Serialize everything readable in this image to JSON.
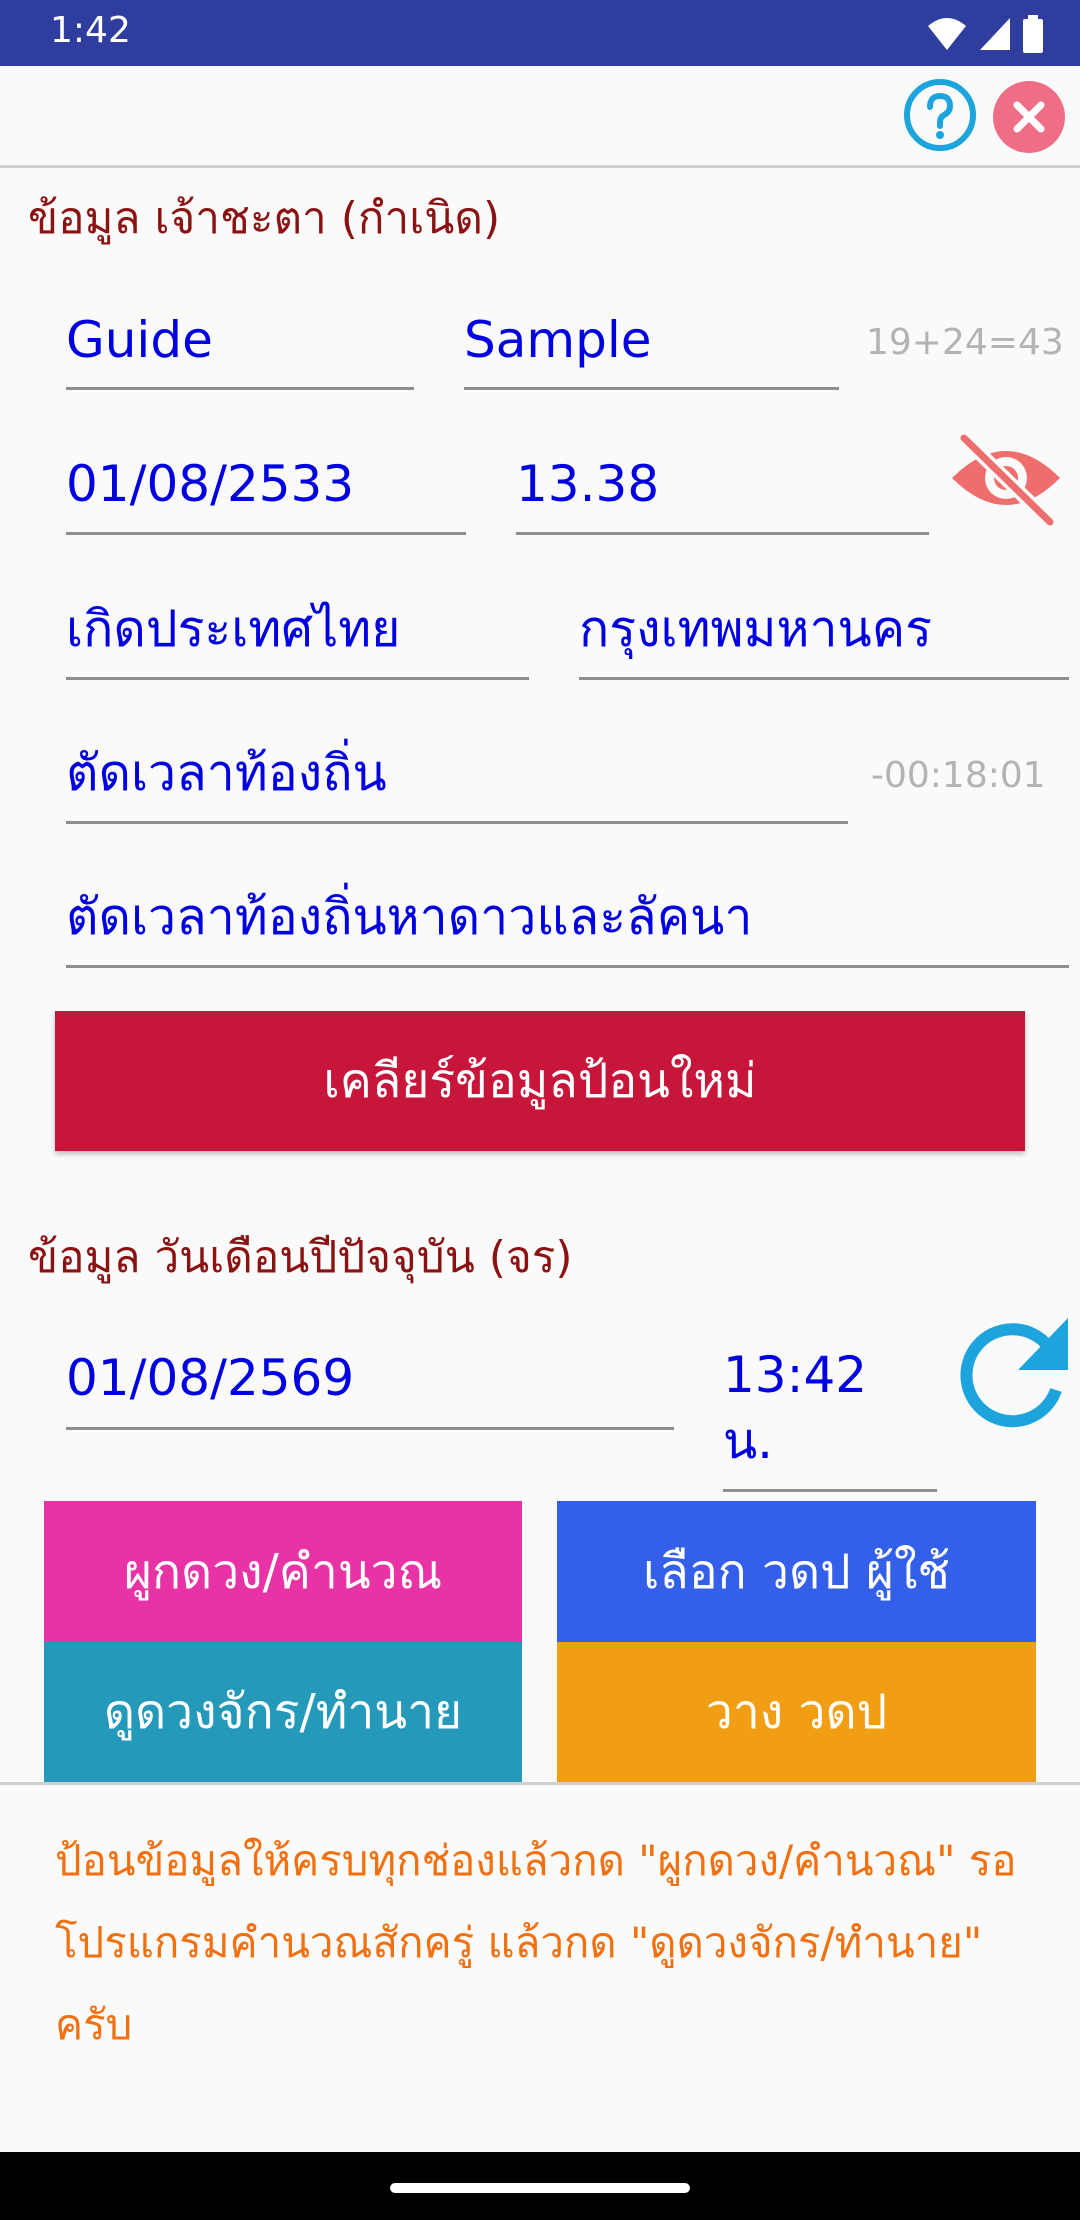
{
  "status_bar": {
    "time": "1:42"
  },
  "header": {
    "help_icon": "help-circle-icon",
    "close_icon": "close-icon"
  },
  "birth_section": {
    "title": "ข้อมูล เจ้าชะตา (กำเนิด)",
    "first_name": "Guide",
    "last_name": "Sample",
    "name_count": "19+24=43",
    "birth_date": "01/08/2533",
    "birth_time": "13.38",
    "visibility_icon": "eye-off-icon",
    "country": "เกิดประเทศไทย",
    "province": "กรุงเทพมหานคร",
    "local_time_option": "ตัดเวลาท้องถิ่น",
    "local_time_offset": "-00:18:01",
    "local_time_star_option": "ตัดเวลาท้องถิ่นหาดาวและลัคนา",
    "clear_button": "เคลียร์ข้อมูลป้อนใหม่"
  },
  "current_section": {
    "title": "ข้อมูล วันเดือนปีปัจจุบัน (จร)",
    "date": "01/08/2569",
    "time": "13:42",
    "time_unit": "น.",
    "refresh_icon": "refresh-icon"
  },
  "actions": {
    "calculate": "ผูกดวง/คำนวณ",
    "choose_chart": "เลือก วดป ผู้ใช้",
    "view_chart": "ดูดวงจักร/ทำนาย",
    "place_chart": "วาง วดป"
  },
  "instruction_lines": [
    "ป้อนข้อมูลให้ครบทุกช่องแล้วกด \"ผูกดวง/คำนวณ\" รอ",
    "โปรแกรมคำนวณสักครู่ แล้วกด \"ดูดวงจักร/ทำนาย\" ครับ"
  ],
  "colors": {
    "status_bar": "#2f3e9e",
    "section_title": "#8b1212",
    "field_text": "#0000e0",
    "clear_button": "#c8163a",
    "calculate_button": "#e733a6",
    "choose_button": "#345fe8",
    "view_button": "#2599b9",
    "place_button": "#f29e14",
    "instruction_text": "#f2700f"
  }
}
